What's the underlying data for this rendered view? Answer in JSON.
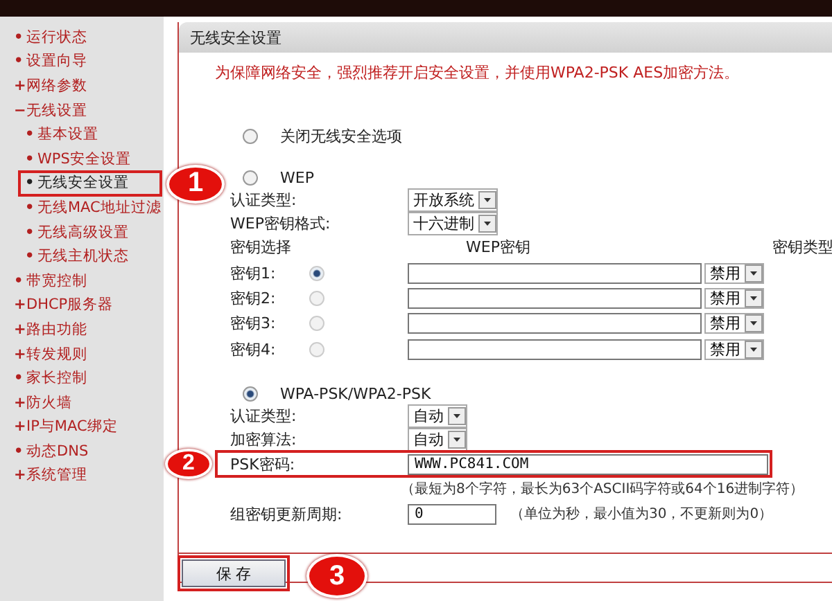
{
  "sidebar": {
    "items": [
      {
        "marker": "•",
        "label": "运行状态",
        "selected": false
      },
      {
        "marker": "•",
        "label": "设置向导",
        "selected": false
      },
      {
        "marker": "+",
        "label": "网络参数",
        "selected": false
      },
      {
        "marker": "−",
        "label": "无线设置",
        "selected": false,
        "children": [
          {
            "marker": "•",
            "label": "基本设置",
            "selected": false
          },
          {
            "marker": "•",
            "label": "WPS安全设置",
            "selected": false
          },
          {
            "marker": "•",
            "label": "无线安全设置",
            "selected": true,
            "callout": "1"
          },
          {
            "marker": "•",
            "label": "无线MAC地址过滤",
            "selected": false
          },
          {
            "marker": "•",
            "label": "无线高级设置",
            "selected": false
          },
          {
            "marker": "•",
            "label": "无线主机状态",
            "selected": false
          }
        ]
      },
      {
        "marker": "•",
        "label": "带宽控制",
        "selected": false
      },
      {
        "marker": "+",
        "label": "DHCP服务器",
        "selected": false
      },
      {
        "marker": "+",
        "label": "路由功能",
        "selected": false
      },
      {
        "marker": "+",
        "label": "转发规则",
        "selected": false
      },
      {
        "marker": "•",
        "label": "家长控制",
        "selected": false
      },
      {
        "marker": "+",
        "label": "防火墙",
        "selected": false
      },
      {
        "marker": "+",
        "label": "IP与MAC绑定",
        "selected": false
      },
      {
        "marker": "•",
        "label": "动态DNS",
        "selected": false
      },
      {
        "marker": "+",
        "label": "系统管理",
        "selected": false
      }
    ]
  },
  "panel": {
    "title": "无线安全设置",
    "notice": "为保障网络安全，强烈推荐开启安全设置，并使用WPA2-PSK AES加密方法。",
    "modes": [
      {
        "kind": "off",
        "label": "关闭无线安全选项",
        "selected": false
      },
      {
        "kind": "wep",
        "label": "WEP",
        "selected": false,
        "fields": [
          {
            "kind": "select",
            "label": "认证类型:",
            "value": "开放系统"
          },
          {
            "kind": "select",
            "label": "WEP密钥格式:",
            "value": "十六进制"
          }
        ],
        "key_table": {
          "columns": [
            "密钥选择",
            "WEP密钥",
            "密钥类型"
          ],
          "keys": [
            {
              "label": "密钥1:",
              "selected": true,
              "type": "禁用"
            },
            {
              "label": "密钥2:",
              "selected": false,
              "type": "禁用"
            },
            {
              "label": "密钥3:",
              "selected": false,
              "type": "禁用"
            },
            {
              "label": "密钥4:",
              "selected": false,
              "type": "禁用"
            }
          ]
        }
      },
      {
        "kind": "wpa",
        "label": "WPA-PSK/WPA2-PSK",
        "selected": true,
        "fields": [
          {
            "kind": "select",
            "label": "认证类型:",
            "value": "自动"
          },
          {
            "kind": "select",
            "label": "加密算法:",
            "value": "自动"
          },
          {
            "kind": "text",
            "label": "PSK密码:",
            "value": "WWW.PC841.COM",
            "hint": "（最短为8个字符，最长为63个ASCII码字符或64个16进制字符）",
            "callout": "2"
          },
          {
            "kind": "short",
            "label": "组密钥更新周期:",
            "value": "0",
            "note": "（单位为秒，最小值为30，不更新则为0）"
          }
        ]
      }
    ]
  },
  "save_button": {
    "label": "保 存",
    "callout": "3"
  }
}
